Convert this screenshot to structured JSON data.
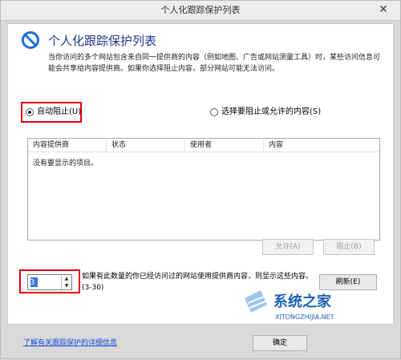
{
  "window": {
    "title": "个人化跟踪保护列表",
    "close_glyph": "✕"
  },
  "header": {
    "title": "个人化跟踪保护列表",
    "description": "当你访问的多个网站包含来自同一提供商的内容（例如地图、广告或网站测量工具）时，某些访问信息可能会共享给内容提供商。如果你选择阻止内容，部分网站可能无法访问。"
  },
  "options": {
    "auto_block": "自动阻止(U)",
    "choose_block": "选择要阻止或允许的内容(S)",
    "selected": "auto_block"
  },
  "list": {
    "columns": [
      "内容提供商",
      "状态",
      "使用者",
      "内容"
    ],
    "empty_text": "没有要显示的项目。"
  },
  "buttons": {
    "allow": "允许(A)",
    "block": "阻止(B)",
    "refresh": "刷新(E)",
    "ok": "确定"
  },
  "threshold": {
    "value": "3",
    "text": "如果有此数量的你已经访问过的网站使用提供商内容，则显示这些内容。(3-30)"
  },
  "footer": {
    "link": "了解有关跟踪保护的详细信息"
  },
  "watermark": {
    "name": "系统之家",
    "url": "XITONGZHIJIA.NET"
  },
  "colors": {
    "highlight": "#e60012",
    "link": "#1a4fd6",
    "title_text": "#1e3a8a",
    "icon": "#1e6fd9"
  }
}
